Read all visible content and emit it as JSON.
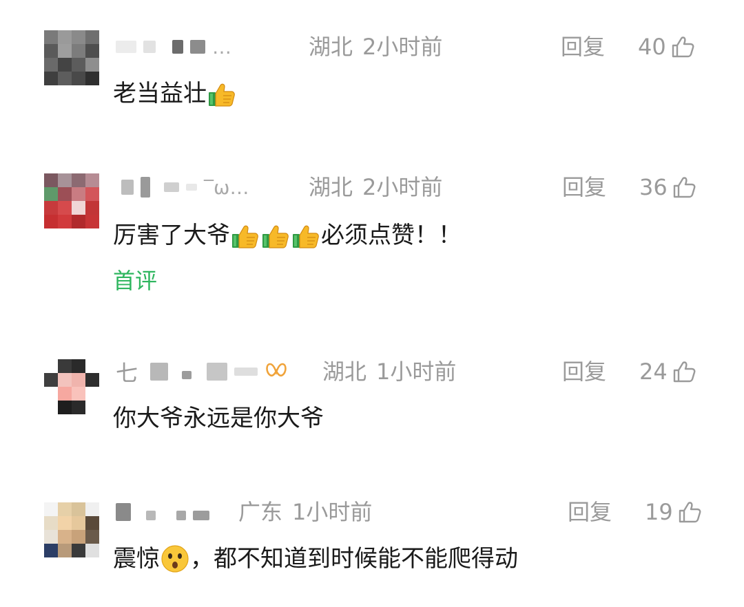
{
  "comments": [
    {
      "name_tail": "…",
      "location": "湖北",
      "time": "2小时前",
      "reply_label": "回复",
      "likes": "40",
      "text": "老当益壮",
      "emoji": "thumbs-up",
      "badge": ""
    },
    {
      "name_tail": "‾ω…",
      "location": "湖北",
      "time": "2小时前",
      "reply_label": "回复",
      "likes": "36",
      "text_before": "厉害了大爷",
      "text_after": "必须点赞！！",
      "emoji": "thumbs-up",
      "badge": "首评"
    },
    {
      "name_head": "七",
      "location": "湖北",
      "time": "1小时前",
      "reply_label": "回复",
      "likes": "24",
      "text": "你大爷永远是你大爷",
      "badge_icon": "vip-icon"
    },
    {
      "location": "广东",
      "time": "1小时前",
      "reply_label": "回复",
      "likes": "19",
      "text_before": "震惊",
      "text_after": "，都不知道到时候能不能爬得动",
      "emoji": "astonished-face"
    }
  ],
  "colors": {
    "meta": "#9a9a9a",
    "badge": "#2fb65f",
    "text": "#1a1a1a"
  }
}
